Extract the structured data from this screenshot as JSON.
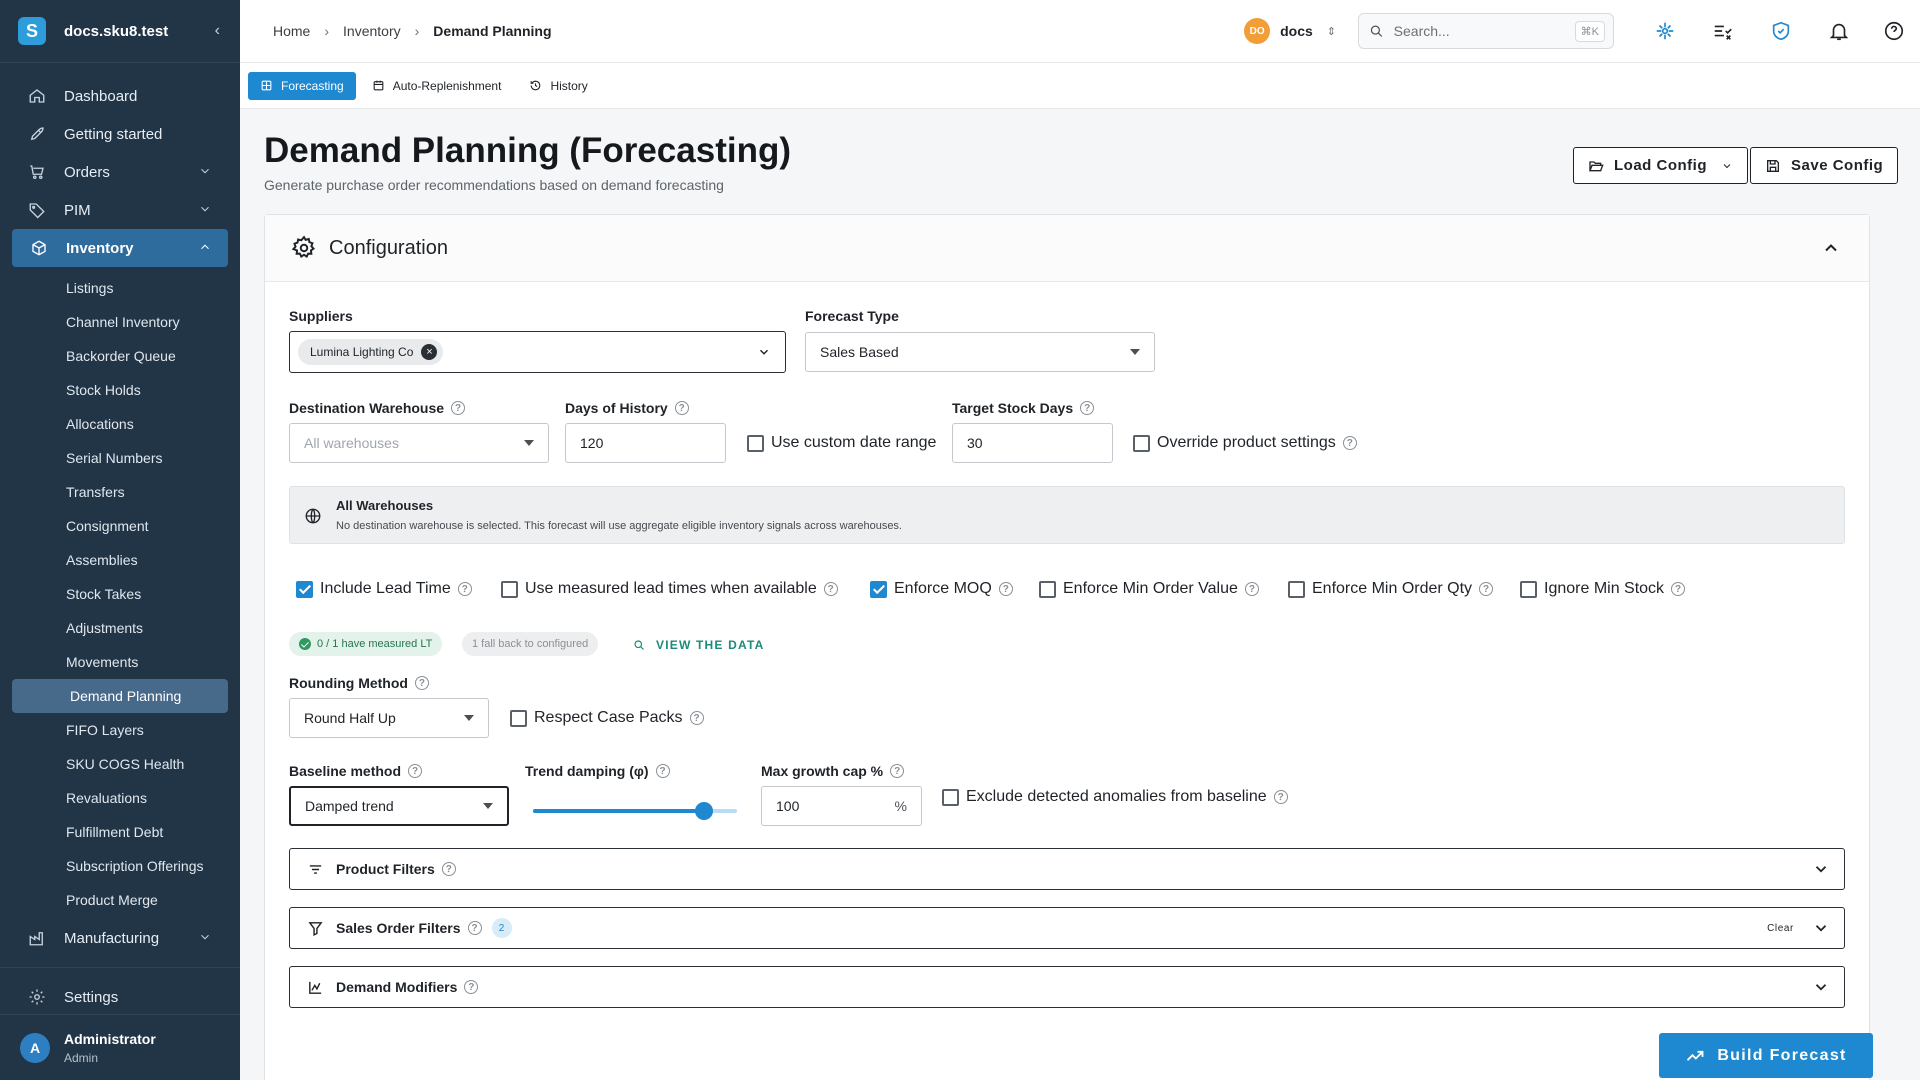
{
  "app": {
    "brand": "docs.sku8.test",
    "logo_letter": "S"
  },
  "sidebar": {
    "items": [
      {
        "label": "Dashboard",
        "icon": "home-icon"
      },
      {
        "label": "Getting started",
        "icon": "rocket-icon"
      },
      {
        "label": "Orders",
        "icon": "cart-icon"
      },
      {
        "label": "PIM",
        "icon": "tag-icon"
      },
      {
        "label": "Inventory",
        "icon": "cube-icon"
      }
    ],
    "inventory_sub": [
      "Listings",
      "Channel Inventory",
      "Backorder Queue",
      "Stock Holds",
      "Allocations",
      "Serial Numbers",
      "Transfers",
      "Consignment",
      "Assemblies",
      "Stock Takes",
      "Adjustments",
      "Movements",
      "Demand Planning",
      "FIFO Layers",
      "SKU COGS Health",
      "Revaluations",
      "Fulfillment Debt",
      "Subscription Offerings",
      "Product Merge"
    ],
    "manufacturing": "Manufacturing",
    "settings": "Settings",
    "user": {
      "initial": "A",
      "name": "Administrator",
      "role": "Admin"
    }
  },
  "header": {
    "breadcrumb": [
      "Home",
      "Inventory",
      "Demand Planning"
    ],
    "org": {
      "initials": "DO",
      "name": "docs"
    },
    "search": {
      "placeholder": "Search...",
      "shortcut": "⌘K"
    }
  },
  "tabs": [
    "Forecasting",
    "Auto-Replenishment",
    "History"
  ],
  "page": {
    "title": "Demand Planning (Forecasting)",
    "subtitle": "Generate purchase order recommendations based on demand forecasting",
    "load_config": "Load Config",
    "save_config": "Save Config"
  },
  "config": {
    "title": "Configuration",
    "suppliers_label": "Suppliers",
    "supplier_chip": "Lumina Lighting Co",
    "forecast_type_label": "Forecast Type",
    "forecast_type_value": "Sales Based",
    "dest_wh_label": "Destination Warehouse",
    "dest_wh_placeholder": "All warehouses",
    "days_history_label": "Days of History",
    "days_history_value": "120",
    "custom_date_label": "Use custom date range",
    "custom_date_checked": false,
    "target_days_label": "Target Stock Days",
    "target_days_value": "30",
    "override_label": "Override product settings",
    "override_checked": false,
    "alert_title": "All Warehouses",
    "alert_text": "No destination warehouse is selected. This forecast will use aggregate eligible inventory signals across warehouses.",
    "options": [
      {
        "label": "Include Lead Time",
        "checked": true
      },
      {
        "label": "Use measured lead times when available",
        "checked": false
      },
      {
        "label": "Enforce MOQ",
        "checked": true
      },
      {
        "label": "Enforce Min Order Value",
        "checked": false
      },
      {
        "label": "Enforce Min Order Qty",
        "checked": false
      },
      {
        "label": "Ignore Min Stock",
        "checked": false
      }
    ],
    "measured_pill": "0 / 1 have measured LT",
    "fallback_pill": "1 fall back to configured",
    "view_data": "VIEW THE DATA",
    "rounding_label": "Rounding Method",
    "rounding_value": "Round Half Up",
    "case_packs_label": "Respect Case Packs",
    "case_packs_checked": false,
    "baseline_label": "Baseline method",
    "baseline_value": "Damped trend",
    "trend_label": "Trend damping (φ)",
    "trend_fraction": 0.84,
    "growth_label": "Max growth cap %",
    "growth_value": "100",
    "growth_unit": "%",
    "anomalies_label": "Exclude detected anomalies from baseline",
    "anomalies_checked": false,
    "product_filters": "Product Filters",
    "sales_filters": "Sales Order Filters",
    "sales_filters_count": "2",
    "clear": "Clear",
    "demand_modifiers": "Demand Modifiers",
    "build": "Build Forecast"
  },
  "colors": {
    "accent": "#1e88d0",
    "sidebar": "#213547",
    "success": "#2e9a5f"
  }
}
